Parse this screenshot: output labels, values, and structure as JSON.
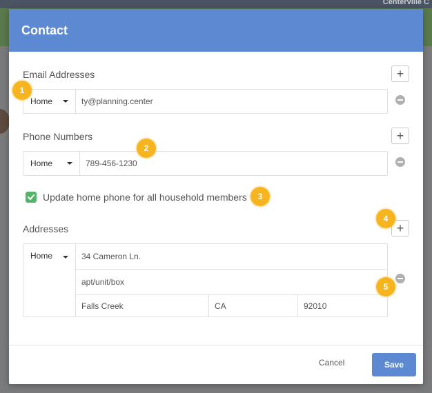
{
  "background": {
    "user_name": "Centerville C"
  },
  "modal": {
    "title": "Contact",
    "email": {
      "section_label": "Email Addresses",
      "type": "Home",
      "value": "ty@planning.center"
    },
    "phone": {
      "section_label": "Phone Numbers",
      "type": "Home",
      "value": "789-456-1230"
    },
    "household_checkbox": {
      "label": "Update home phone for all household members",
      "checked": true
    },
    "address": {
      "section_label": "Addresses",
      "type": "Home",
      "street": "34 Cameron Ln.",
      "street2_placeholder": "apt/unit/box",
      "city": "Falls Creek",
      "state": "CA",
      "zip": "92010"
    },
    "footer": {
      "cancel_label": "Cancel",
      "save_label": "Save"
    }
  },
  "annotations": [
    "1",
    "2",
    "3",
    "4",
    "5"
  ],
  "colors": {
    "header": "#5d89d3",
    "save_button": "#5d89d3",
    "checkbox": "#55b46a",
    "badge": "#f6b51e"
  },
  "icons": [
    "plus-icon",
    "minus-icon",
    "chevron-down-icon",
    "check-icon"
  ]
}
